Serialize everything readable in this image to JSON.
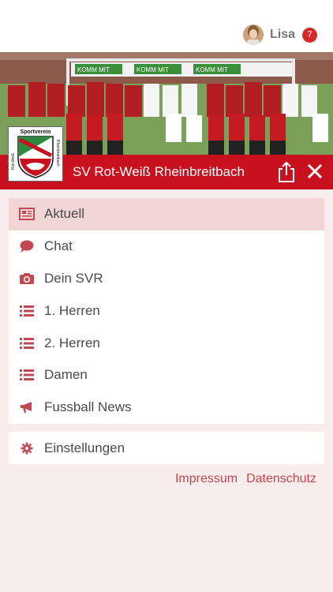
{
  "header": {
    "user_name": "Lisa",
    "notification_count": "7"
  },
  "club": {
    "name": "SV Rot-Weiß Rheinbreitbach",
    "crest_text_top": "Sportverein",
    "crest_text_left": "Rot-Weiß",
    "crest_text_right": "Rheinbreitbach"
  },
  "banner_text": [
    "KOMM MIT",
    "KOMM MIT",
    "KOMM MIT"
  ],
  "menu": {
    "items": [
      {
        "label": "Aktuell",
        "icon": "newspaper-icon",
        "active": true
      },
      {
        "label": "Chat",
        "icon": "chat-bubble-icon",
        "active": false
      },
      {
        "label": "Dein SVR",
        "icon": "camera-icon",
        "active": false
      },
      {
        "label": "1. Herren",
        "icon": "list-icon",
        "active": false
      },
      {
        "label": "2. Herren",
        "icon": "list-icon",
        "active": false
      },
      {
        "label": "Damen",
        "icon": "list-icon",
        "active": false
      },
      {
        "label": "Fussball News",
        "icon": "megaphone-icon",
        "active": false
      }
    ],
    "settings_label": "Einstellungen",
    "settings_icon": "gear-icon"
  },
  "footer": {
    "impressum": "Impressum",
    "datenschutz": "Datenschutz"
  },
  "colors": {
    "brand_red": "#c8101e",
    "icon_red": "#c0484e",
    "background": "#f9ecec",
    "active_row": "#f2d6d6"
  }
}
